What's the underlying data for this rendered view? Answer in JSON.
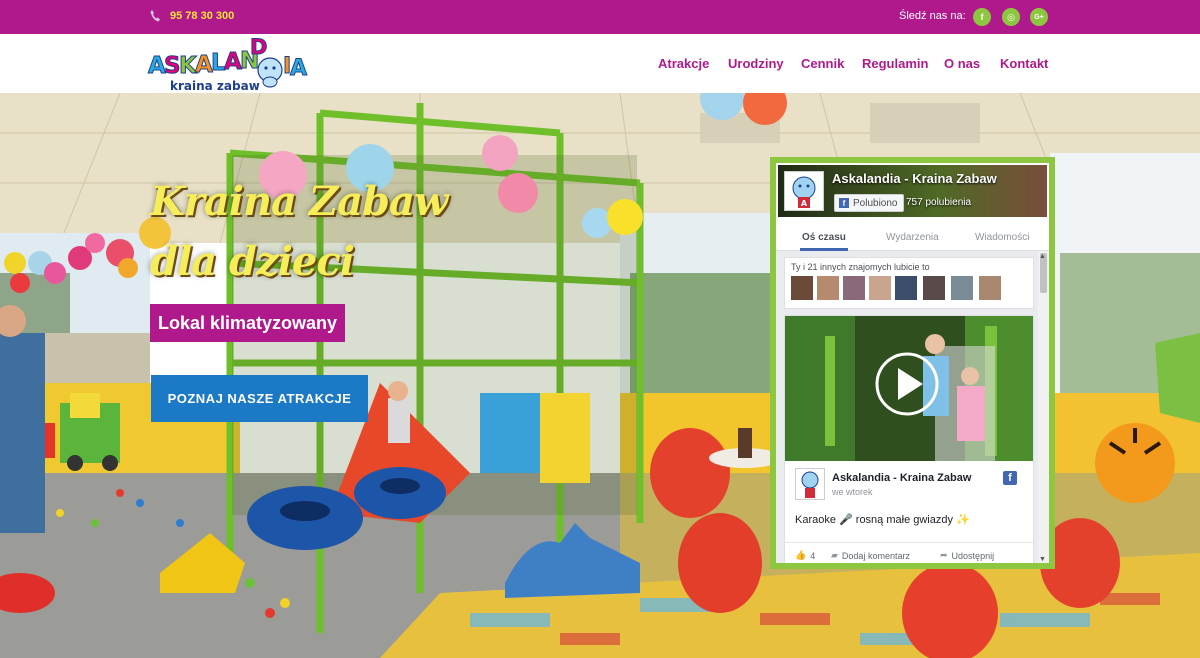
{
  "topbar": {
    "phone": "95 78 30 300",
    "follow_label": "Śledź nas na:",
    "social": [
      {
        "icon": "facebook-icon",
        "glyph": "f"
      },
      {
        "icon": "instagram-icon",
        "glyph": "◎"
      },
      {
        "icon": "google-plus-icon",
        "glyph": "G+"
      }
    ],
    "bg_color": "#b0198c",
    "phone_color": "#f7e63a"
  },
  "header": {
    "logo": {
      "word": "ASKALANDIA",
      "tagline": "kraina zabaw"
    },
    "nav": [
      {
        "label": "Atrakcje"
      },
      {
        "label": "Urodziny"
      },
      {
        "label": "Cennik"
      },
      {
        "label": "Regulamin"
      },
      {
        "label": "O nas"
      },
      {
        "label": "Kontakt"
      }
    ],
    "accent_color": "#b0198c"
  },
  "hero": {
    "title": "Kraina Zabaw",
    "subtitle": "dla dzieci",
    "badge": "Lokal klimatyzowany",
    "cta": "POZNAJ NASZE ATRAKCJE",
    "cta_color": "#1b79c6",
    "title_color": "#f6ed5a"
  },
  "facebook": {
    "page_name": "Askalandia - Kraina Zabaw",
    "like_button": "Polubiono",
    "likes": "757 polubienia",
    "tabs": [
      "Oś czasu",
      "Wydarzenia",
      "Wiadomości"
    ],
    "friends_text": "Ty i 21 innych znajomych lubicie to",
    "post": {
      "author": "Askalandia - Kraina Zabaw",
      "time": "we wtorek",
      "text": "Karaoke 🎤 rosną małe gwiazdy ✨",
      "likes": "4",
      "comment_label": "Dodaj komentarz",
      "share_label": "Udostępnij"
    },
    "border_color": "#8dc63f"
  }
}
